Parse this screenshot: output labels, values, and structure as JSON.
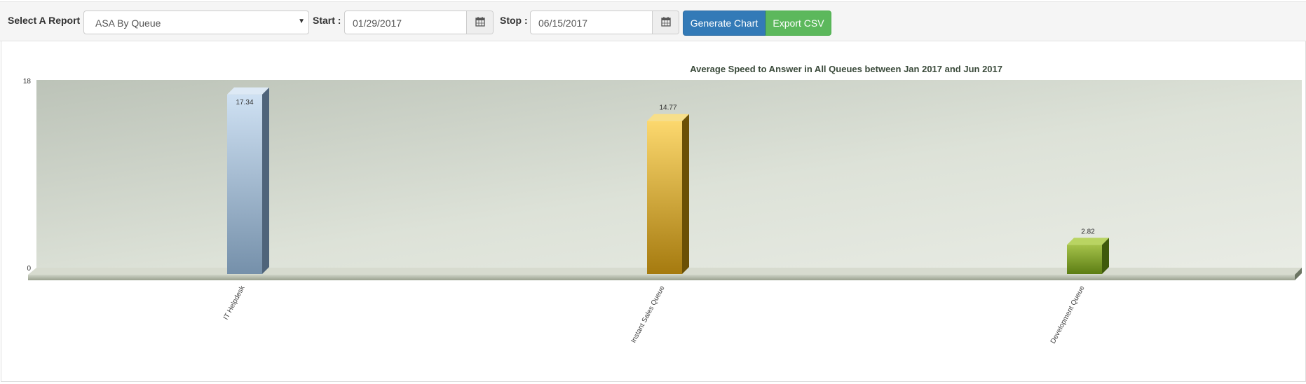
{
  "toolbar": {
    "report_label": "Select A Report",
    "report_value": "ASA By Queue",
    "start_label": "Start :",
    "start_value": "01/29/2017",
    "stop_label": "Stop :",
    "stop_value": "06/15/2017",
    "generate_label": "Generate Chart",
    "export_label": "Export CSV"
  },
  "chart_data": {
    "type": "bar",
    "title": "Average Speed to Answer in All Queues between Jan 2017 and Jun 2017",
    "categories": [
      "IT Helpdesk",
      "Instant Sales Queue",
      "Development Queue"
    ],
    "values": [
      17.34,
      14.77,
      2.82
    ],
    "value_labels": [
      "17.34",
      "14.77",
      "2.82"
    ],
    "ylim": [
      0,
      18
    ],
    "y_ticks": [
      "0",
      "18"
    ],
    "bar_colors": [
      "#a6bed6",
      "#d9a52a",
      "#7fa12a"
    ],
    "grid": false,
    "legend": "none"
  }
}
